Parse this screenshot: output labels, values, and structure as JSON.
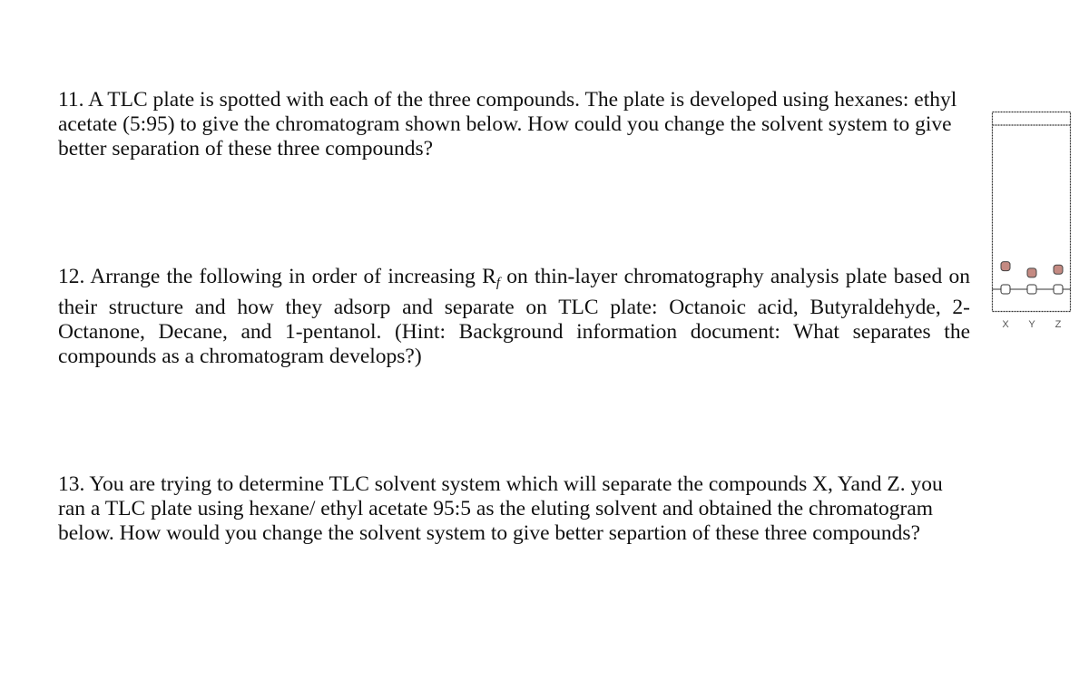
{
  "questions": [
    {
      "number": "11.",
      "text": "A TLC plate is spotted with each of the three compounds. The plate is developed using hexanes: ethyl acetate (5:95) to give the chromatogram shown below. How could you change the solvent system to give better separation of these three compounds?"
    },
    {
      "number": "12.",
      "text_before_rf": "Arrange the following in order of increasing R",
      "rf_subscript": "f",
      "text_after_rf": " on thin-layer chromatography analysis plate based on their structure and how they adsorp and separate on TLC plate: Octanoic acid, Butyraldehyde, 2-Octanone, Decane, and 1-pentanol. (Hint: Background information document: What separates the compounds as a chromatogram develops?)"
    },
    {
      "number": "13.",
      "text": "You are trying to determine TLC solvent system which will separate the compounds X, Yand Z. you ran a TLC plate using hexane/ ethyl acetate 95:5 as the eluting solvent and obtained the chromatogram below. How would you change the solvent system to give better separtion of these three compounds?"
    }
  ],
  "tlc_plate": {
    "lanes": [
      "X",
      "Y",
      "Z"
    ],
    "spot_color": "#c48a82",
    "spot_outline": "#444444",
    "spots_rf": [
      {
        "lane": "X",
        "rf": 0.14
      },
      {
        "lane": "Y",
        "rf": 0.1
      },
      {
        "lane": "Z",
        "rf": 0.12
      }
    ]
  }
}
